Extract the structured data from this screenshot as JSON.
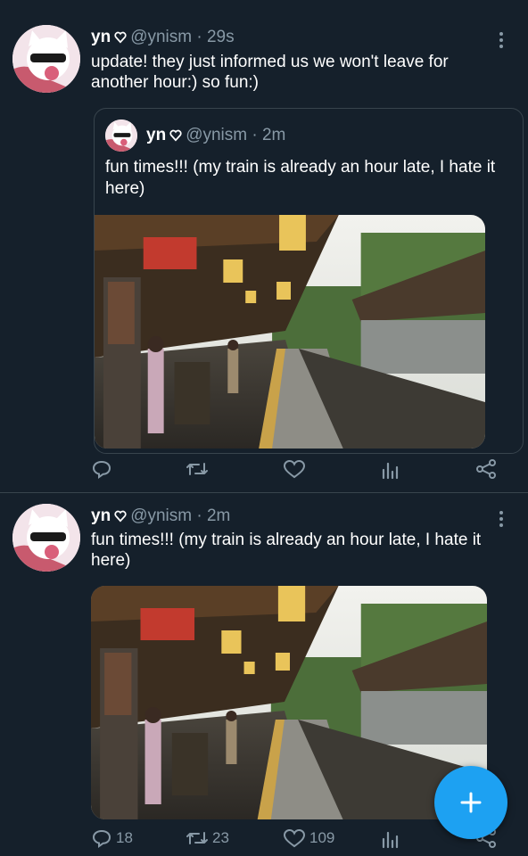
{
  "tweets": [
    {
      "name": "yn",
      "handle": "@ynism",
      "dot": "·",
      "time": "29s",
      "text": "update! they just informed us we won't leave for another hour:) so fun:)",
      "quoted": {
        "name": "yn",
        "handle": "@ynism",
        "dot": "·",
        "time": "2m",
        "text": "fun times!!! (my train is already an hour late, I hate it here)"
      },
      "counts": {
        "reply": "",
        "retweet": "",
        "like": ""
      }
    },
    {
      "name": "yn",
      "handle": "@ynism",
      "dot": "·",
      "time": "2m",
      "text": "fun times!!! (my train is already an hour late, I hate it here)",
      "counts": {
        "reply": "18",
        "retweet": "23",
        "like": "109"
      }
    }
  ],
  "icons": {
    "reply": "reply-icon",
    "retweet": "retweet-icon",
    "like": "heart-icon",
    "analytics": "analytics-icon",
    "share": "share-icon",
    "compose": "plus-icon",
    "more": "more-vertical-icon"
  },
  "colors": {
    "background": "#15202b",
    "secondary_text": "#8899a6",
    "accent": "#1da1f2",
    "border": "#38444d"
  }
}
